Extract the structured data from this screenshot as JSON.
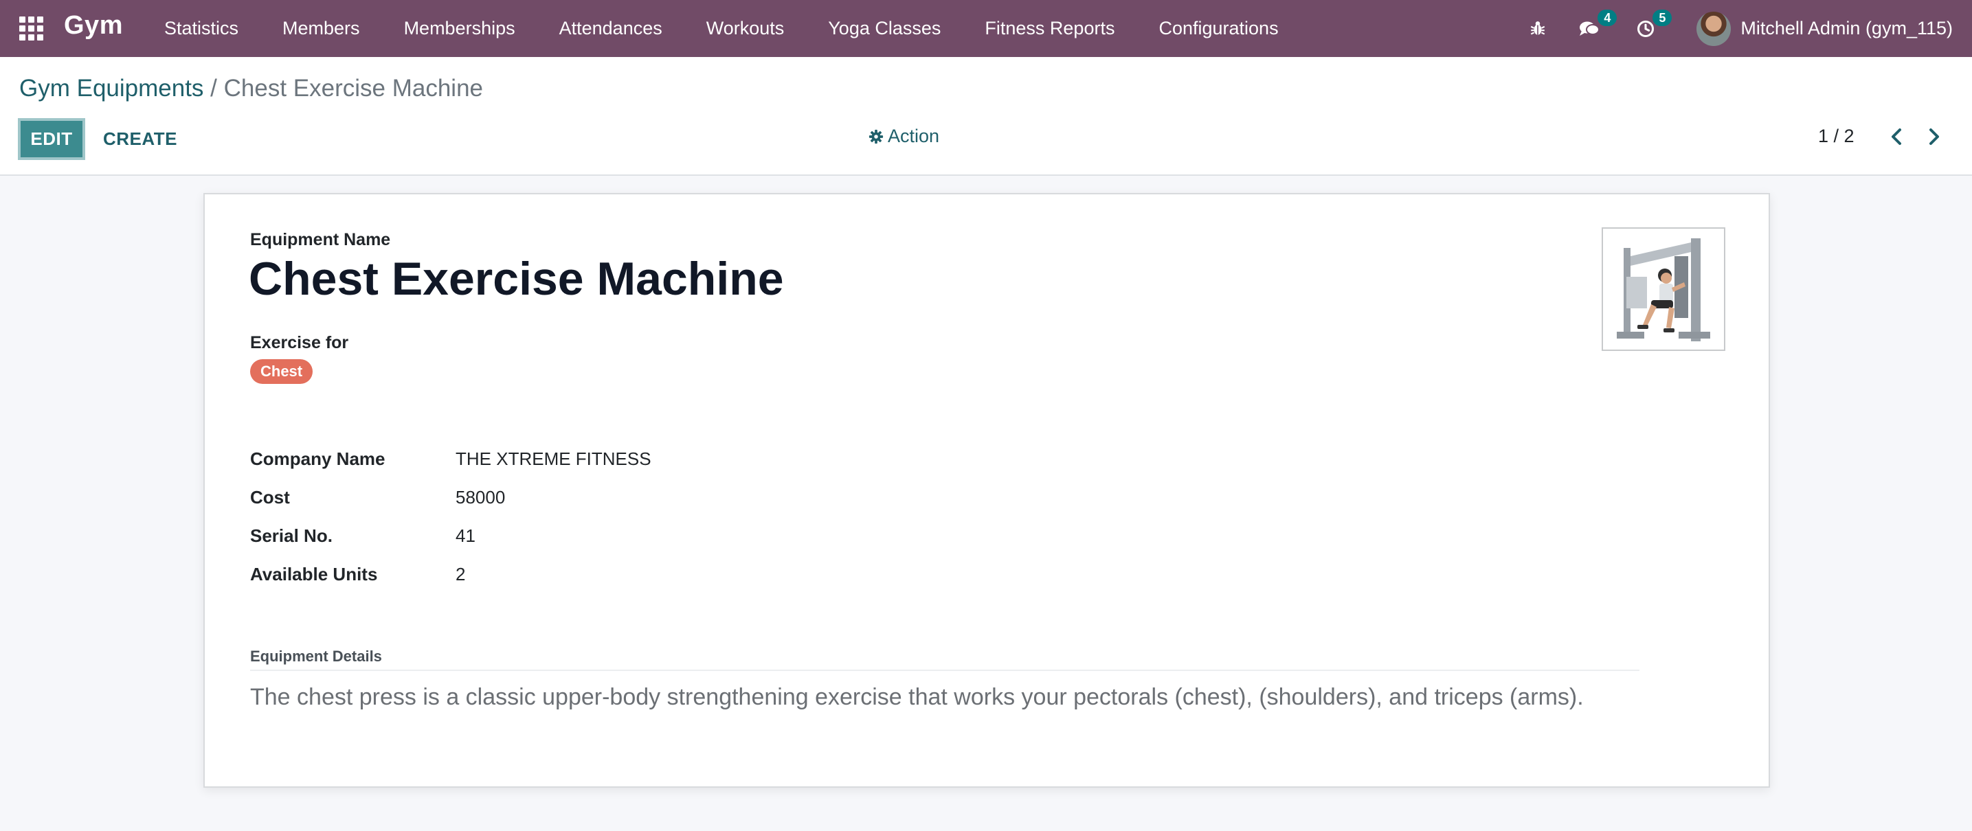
{
  "navbar": {
    "brand": "Gym",
    "menu": [
      {
        "label": "Statistics"
      },
      {
        "label": "Members"
      },
      {
        "label": "Memberships"
      },
      {
        "label": "Attendances"
      },
      {
        "label": "Workouts"
      },
      {
        "label": "Yoga Classes"
      },
      {
        "label": "Fitness Reports"
      },
      {
        "label": "Configurations"
      }
    ],
    "systray": {
      "messages_count": "4",
      "activities_count": "5",
      "user_name": "Mitchell Admin (gym_115)"
    },
    "colors": {
      "background": "#714b67",
      "badge": "#017e84"
    }
  },
  "breadcrumb": {
    "parent": "Gym Equipments",
    "separator": "/",
    "current": "Chest Exercise Machine"
  },
  "toolbar": {
    "edit_label": "EDIT",
    "create_label": "CREATE",
    "action_label": "Action",
    "pager": "1 / 2"
  },
  "form": {
    "name_label": "Equipment Name",
    "name_value": "Chest Exercise Machine",
    "exercise_for_label": "Exercise for",
    "exercise_for_tags": [
      {
        "label": "Chest",
        "color": "#e36f5c"
      }
    ],
    "fields": [
      {
        "label": "Company Name",
        "value": "THE XTREME FITNESS"
      },
      {
        "label": "Cost",
        "value": "58000"
      },
      {
        "label": "Serial No.",
        "value": "41"
      },
      {
        "label": "Available Units",
        "value": "2"
      }
    ],
    "details_label": "Equipment Details",
    "details_text": "The chest press is a classic upper-body strengthening exercise that works your pectorals (chest),  (shoulders), and triceps (arms)."
  },
  "icons": {
    "apps": "apps-grid-icon",
    "bug": "bug-icon",
    "messages": "chat-icon",
    "activities": "clock-icon",
    "action": "gear-icon",
    "prev": "chevron-left-icon",
    "next": "chevron-right-icon"
  }
}
